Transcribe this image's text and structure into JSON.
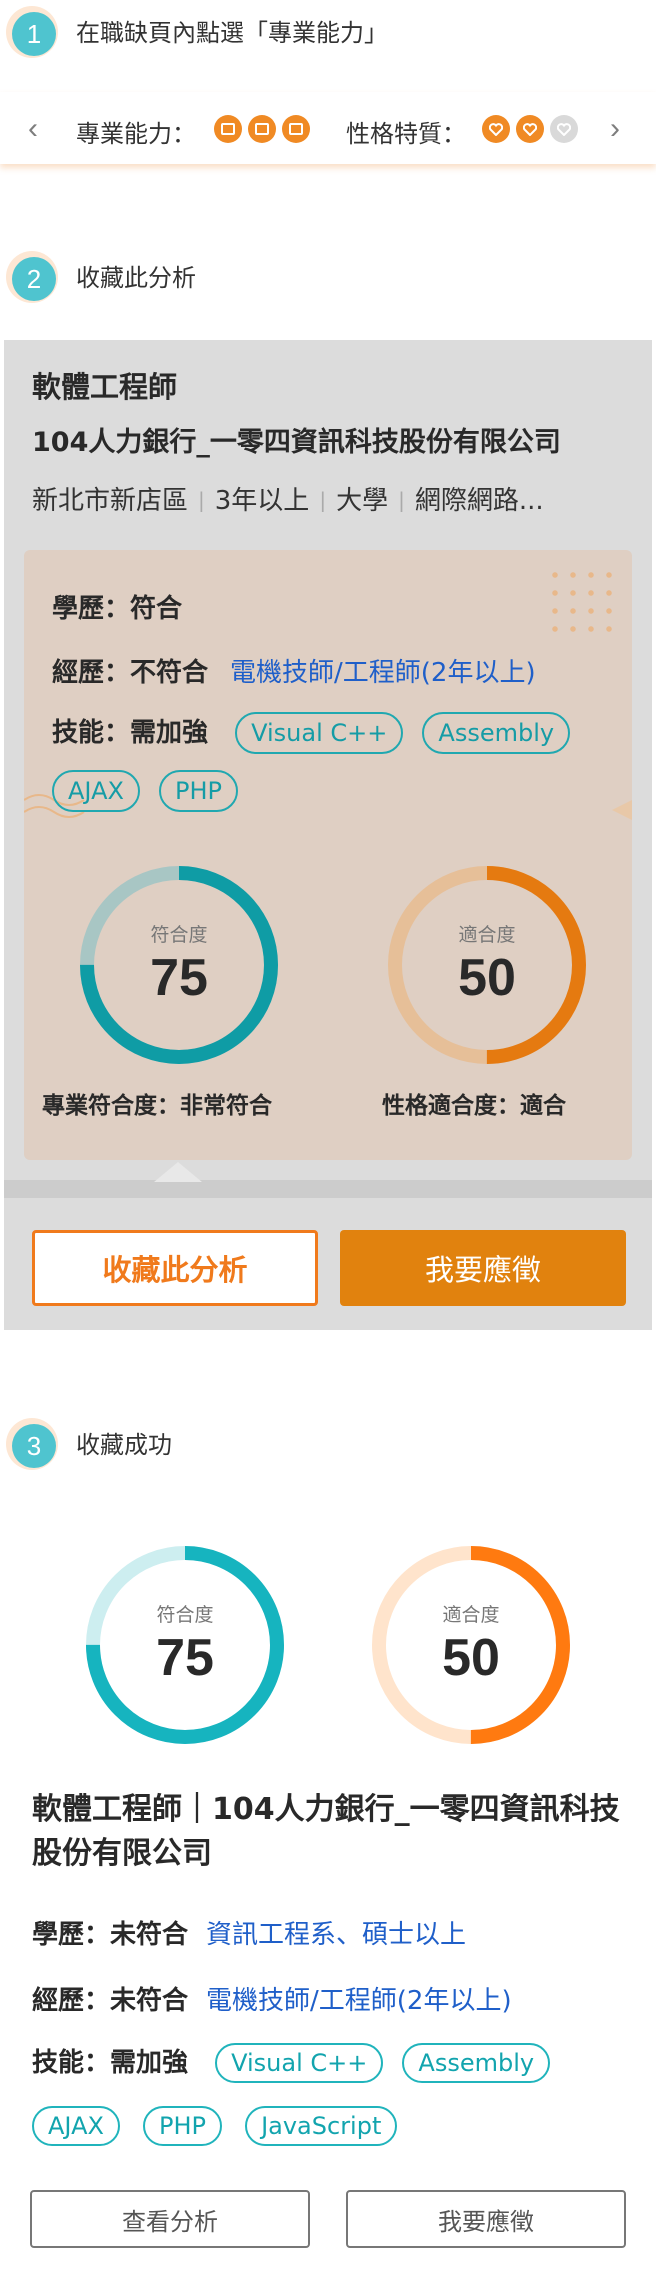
{
  "steps": [
    {
      "num": "1",
      "text": "在職缺頁內點選「專業能力」"
    },
    {
      "num": "2",
      "text": "收藏此分析"
    },
    {
      "num": "3",
      "text": "收藏成功"
    }
  ],
  "navbar": {
    "prev": "‹",
    "next": "›",
    "skill_label": "專業能力：",
    "personality_label": "性格特質：",
    "skill_level": 3,
    "personality_level": 2,
    "level_max": 3,
    "accent": "#f08a24"
  },
  "card": {
    "job_title": "軟體工程師",
    "company": "104人力銀行_一零四資訊科技股份有限公司",
    "meta": [
      "新北市新店區",
      "3年以上",
      "大學",
      "網際網路..."
    ],
    "meta_sep": "|",
    "education": {
      "label": "學歷：",
      "status": "符合"
    },
    "experience": {
      "label": "經歷：",
      "status": "不符合",
      "detail": "電機技師/工程師(2年以上)"
    },
    "skills": {
      "label": "技能：",
      "status": "需加強",
      "tags": [
        "Visual C++",
        "Assembly",
        "AJAX",
        "PHP"
      ]
    },
    "gauges": [
      {
        "label": "符合度",
        "value": "75",
        "percent": 75,
        "caption": "專業符合度：非常符合",
        "color": "#0f9ca5",
        "track": "#a8c6c4"
      },
      {
        "label": "適合度",
        "value": "50",
        "percent": 50,
        "caption": "性格適合度：適合",
        "color": "#e57a10",
        "track": "#e6bf98"
      }
    ],
    "save_button": "收藏此分析",
    "apply_button": "我要應徵"
  },
  "saved": {
    "gauges": [
      {
        "label": "符合度",
        "value": "75",
        "percent": 75,
        "color": "#16b4bf",
        "track": "#cdeef0"
      },
      {
        "label": "適合度",
        "value": "50",
        "percent": 50,
        "color": "#ff7a10",
        "track": "#ffe4cc"
      }
    ],
    "title": "軟體工程師｜104人力銀行_一零四資訊科技股份有限公司",
    "education": {
      "label": "學歷：",
      "status": "未符合",
      "detail": "資訊工程系、碩士以上"
    },
    "experience": {
      "label": "經歷：",
      "status": "未符合",
      "detail": "電機技師/工程師(2年以上)"
    },
    "skills": {
      "label": "技能：",
      "status": "需加強",
      "tags": [
        "Visual C++",
        "Assembly",
        "AJAX",
        "PHP",
        "JavaScript"
      ]
    },
    "view_button": "查看分析",
    "apply_button": "我要應徵"
  }
}
